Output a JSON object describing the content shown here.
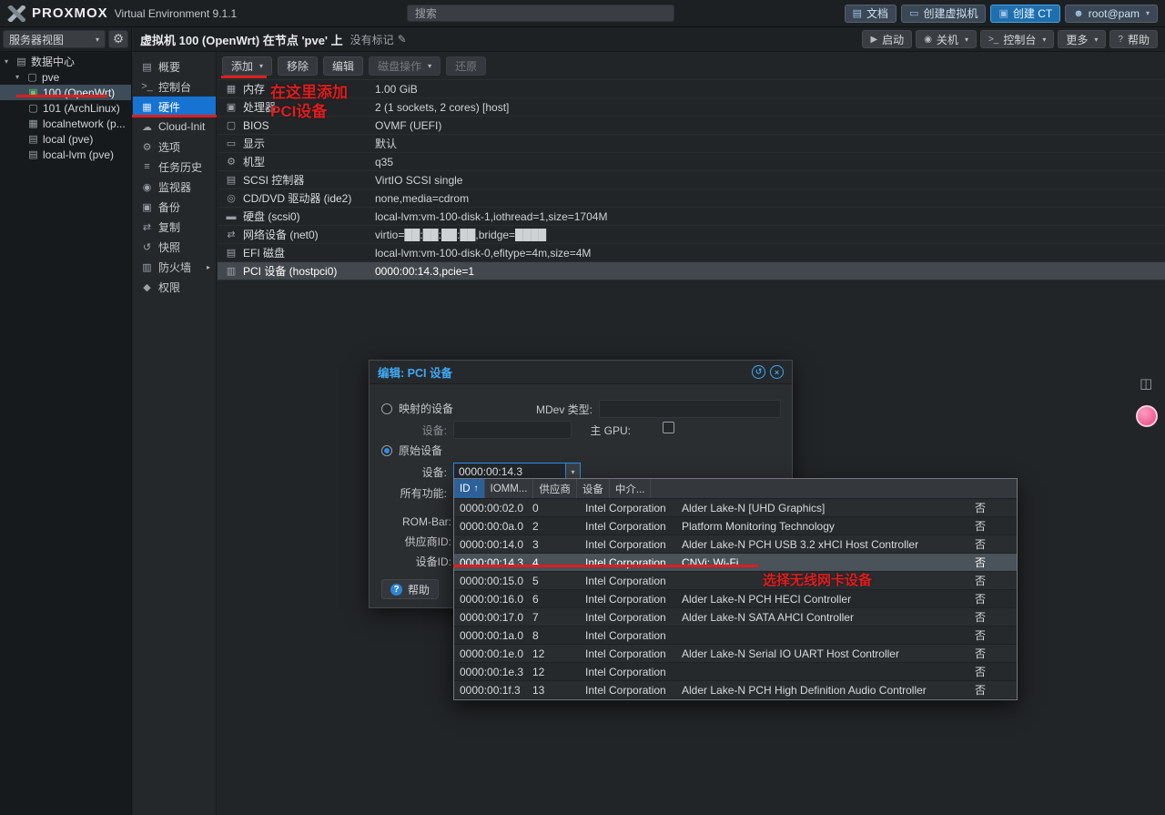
{
  "colors": {
    "accent_blue": "#1673d1",
    "annotation_red": "#dd1e1e",
    "dialog_title_blue": "#3fa9f5",
    "selection_gray": "#4a525a"
  },
  "topbar": {
    "logo_text": "PROXMOX",
    "version_text": "Virtual Environment 9.1.1",
    "search_placeholder": "搜索",
    "buttons": [
      {
        "name": "documentation-button",
        "icon": "doc-icon",
        "label": "文档"
      },
      {
        "name": "create-vm-button",
        "icon": "display-icon",
        "label": "创建虚拟机"
      },
      {
        "name": "create-ct-button",
        "icon": "cube-icon",
        "label": "创建 CT",
        "accent": true
      },
      {
        "name": "user-menu-button",
        "icon": "user-icon",
        "label": "root@pam",
        "caret": true
      }
    ]
  },
  "sidebar": {
    "view_selector_label": "服务器视图",
    "tree": [
      {
        "name": "tree-item-datacenter",
        "icon": "server-icon",
        "label": "数据中心",
        "level": 0,
        "caret": true
      },
      {
        "name": "tree-item-pve",
        "icon": "node-icon",
        "label": "pve",
        "level": 1,
        "caret": true
      },
      {
        "name": "tree-item-vm-100",
        "icon": "vm-running-icon",
        "label": "100 (OpenWrt)",
        "level": 2,
        "selected": true
      },
      {
        "name": "tree-item-vm-101",
        "icon": "vm-stopped-icon",
        "label": "101 (ArchLinux)",
        "level": 2
      },
      {
        "name": "tree-item-localnetwork",
        "icon": "network-icon",
        "label": "localnetwork (p...",
        "level": 2
      },
      {
        "name": "tree-item-storage-local",
        "icon": "storage-icon",
        "label": "local (pve)",
        "level": 2
      },
      {
        "name": "tree-item-storage-local-lvm",
        "icon": "storage-icon",
        "label": "local-lvm (pve)",
        "level": 2
      }
    ]
  },
  "breadcrumb": {
    "title": "虚拟机 100 (OpenWrt) 在节点 'pve' 上",
    "tags": "没有标记",
    "actions": [
      {
        "name": "start-button",
        "icon": "start-icon",
        "label": "启动"
      },
      {
        "name": "shutdown-button",
        "icon": "power-icon",
        "label": "关机",
        "caret": true
      },
      {
        "name": "console-button",
        "icon": "terminal-icon",
        "label": "控制台",
        "caret": true
      },
      {
        "name": "more-button",
        "label": "更多",
        "caret": true
      },
      {
        "name": "help-button",
        "icon": "help-icon",
        "label": "帮助"
      }
    ]
  },
  "vm_menu": [
    {
      "name": "tab-summary",
      "icon": "summary-icon",
      "label": "概要"
    },
    {
      "name": "tab-console",
      "icon": "console-icon",
      "label": "控制台"
    },
    {
      "name": "tab-hardware",
      "icon": "hardware-icon",
      "label": "硬件",
      "selected": true
    },
    {
      "name": "tab-cloudinit",
      "icon": "cloud-icon",
      "label": "Cloud-Init"
    },
    {
      "name": "tab-options",
      "icon": "options-icon",
      "label": "选项"
    },
    {
      "name": "tab-task-history",
      "icon": "history-icon",
      "label": "任务历史"
    },
    {
      "name": "tab-monitor",
      "icon": "eye-icon",
      "label": "监视器"
    },
    {
      "name": "tab-backup",
      "icon": "backup-icon",
      "label": "备份"
    },
    {
      "name": "tab-replication",
      "icon": "replication-icon",
      "label": "复制"
    },
    {
      "name": "tab-snapshots",
      "icon": "snapshot-icon",
      "label": "快照"
    },
    {
      "name": "tab-firewall",
      "icon": "firewall-icon",
      "label": "防火墙",
      "arrow": true
    },
    {
      "name": "tab-permissions",
      "icon": "permissions-icon",
      "label": "权限"
    }
  ],
  "hw_toolbar": [
    {
      "name": "add-button",
      "label": "添加",
      "caret": true
    },
    {
      "name": "remove-button",
      "label": "移除"
    },
    {
      "name": "edit-button",
      "label": "编辑"
    },
    {
      "name": "disk-action-button",
      "label": "磁盘操作",
      "caret": true,
      "disabled": true
    },
    {
      "name": "revert-button",
      "label": "还原",
      "disabled": true
    }
  ],
  "hardware_rows": [
    {
      "icon": "memory-icon",
      "label": "内存",
      "value": "1.00 GiB"
    },
    {
      "icon": "cpu-icon",
      "label": "处理器",
      "value": "2 (1 sockets, 2 cores) [host]"
    },
    {
      "icon": "bios-icon",
      "label": "BIOS",
      "value": "OVMF (UEFI)"
    },
    {
      "icon": "screen-icon",
      "label": "显示",
      "value": "默认"
    },
    {
      "icon": "machine-icon",
      "label": "机型",
      "value": "q35"
    },
    {
      "icon": "scsi-icon",
      "label": "SCSI 控制器",
      "value": "VirtIO SCSI single"
    },
    {
      "icon": "cdrom-icon",
      "label": "CD/DVD 驱动器 (ide2)",
      "value": "none,media=cdrom"
    },
    {
      "icon": "disk-icon",
      "label": "硬盘 (scsi0)",
      "value": "local-lvm:vm-100-disk-1,iothread=1,size=1704M"
    },
    {
      "icon": "net-icon",
      "label": "网络设备 (net0)",
      "value": "virtio=██:██:██:██,bridge=████",
      "redacted": true
    },
    {
      "icon": "efi-icon",
      "label": "EFI 磁盘",
      "value": "local-lvm:vm-100-disk-0,efitype=4m,size=4M"
    },
    {
      "icon": "pci-icon",
      "label": "PCI 设备 (hostpci0)",
      "value": "0000:00:14.3,pcie=1",
      "selected": true
    }
  ],
  "dialog": {
    "title": "编辑: PCI 设备",
    "mapped_device_label": "映射的设备",
    "mapped_device_field_label": "设备:",
    "raw_device_label": "原始设备",
    "device_label": "设备:",
    "device_value": "0000:00:14.3",
    "all_functions_label": "所有功能:",
    "mdev_type_label": "MDev 类型:",
    "primary_gpu_label": "主 GPU:",
    "rom_bar_label": "ROM-Bar:",
    "vendor_id_label": "供应商ID:",
    "device_id_label": "设备ID:",
    "help_label": "帮助"
  },
  "device_picker": {
    "columns": [
      {
        "label": "ID",
        "sorted": true
      },
      {
        "label": "IOMM..."
      },
      {
        "label": "供应商"
      },
      {
        "label": "设备"
      },
      {
        "label": "中介..."
      }
    ],
    "rows": [
      {
        "id": "0000:00:02.0",
        "iommu": "0",
        "vendor": "Intel Corporation",
        "device": "Alder Lake-N [UHD Graphics]",
        "mdev": "否"
      },
      {
        "id": "0000:00:0a.0",
        "iommu": "2",
        "vendor": "Intel Corporation",
        "device": "Platform Monitoring Technology",
        "mdev": "否"
      },
      {
        "id": "0000:00:14.0",
        "iommu": "3",
        "vendor": "Intel Corporation",
        "device": "Alder Lake-N PCH USB 3.2 xHCI Host Controller",
        "mdev": "否"
      },
      {
        "id": "0000:00:14.3",
        "iommu": "4",
        "vendor": "Intel Corporation",
        "device": "CNVi: Wi-Fi",
        "mdev": "否",
        "selected": true
      },
      {
        "id": "0000:00:15.0",
        "iommu": "5",
        "vendor": "Intel Corporation",
        "device": "",
        "mdev": "否"
      },
      {
        "id": "0000:00:16.0",
        "iommu": "6",
        "vendor": "Intel Corporation",
        "device": "Alder Lake-N PCH HECI Controller",
        "mdev": "否"
      },
      {
        "id": "0000:00:17.0",
        "iommu": "7",
        "vendor": "Intel Corporation",
        "device": "Alder Lake-N SATA AHCI Controller",
        "mdev": "否"
      },
      {
        "id": "0000:00:1a.0",
        "iommu": "8",
        "vendor": "Intel Corporation",
        "device": "",
        "mdev": "否"
      },
      {
        "id": "0000:00:1e.0",
        "iommu": "12",
        "vendor": "Intel Corporation",
        "device": "Alder Lake-N Serial IO UART Host Controller",
        "mdev": "否"
      },
      {
        "id": "0000:00:1e.3",
        "iommu": "12",
        "vendor": "Intel Corporation",
        "device": "",
        "mdev": "否"
      },
      {
        "id": "0000:00:1f.3",
        "iommu": "13",
        "vendor": "Intel Corporation",
        "device": "Alder Lake-N PCH High Definition Audio Controller",
        "mdev": "否"
      }
    ]
  },
  "annotations": {
    "add_hint_line1": "在这里添加",
    "add_hint_line2": "PCI设备",
    "select_hint": "选择无线网卡设备"
  }
}
